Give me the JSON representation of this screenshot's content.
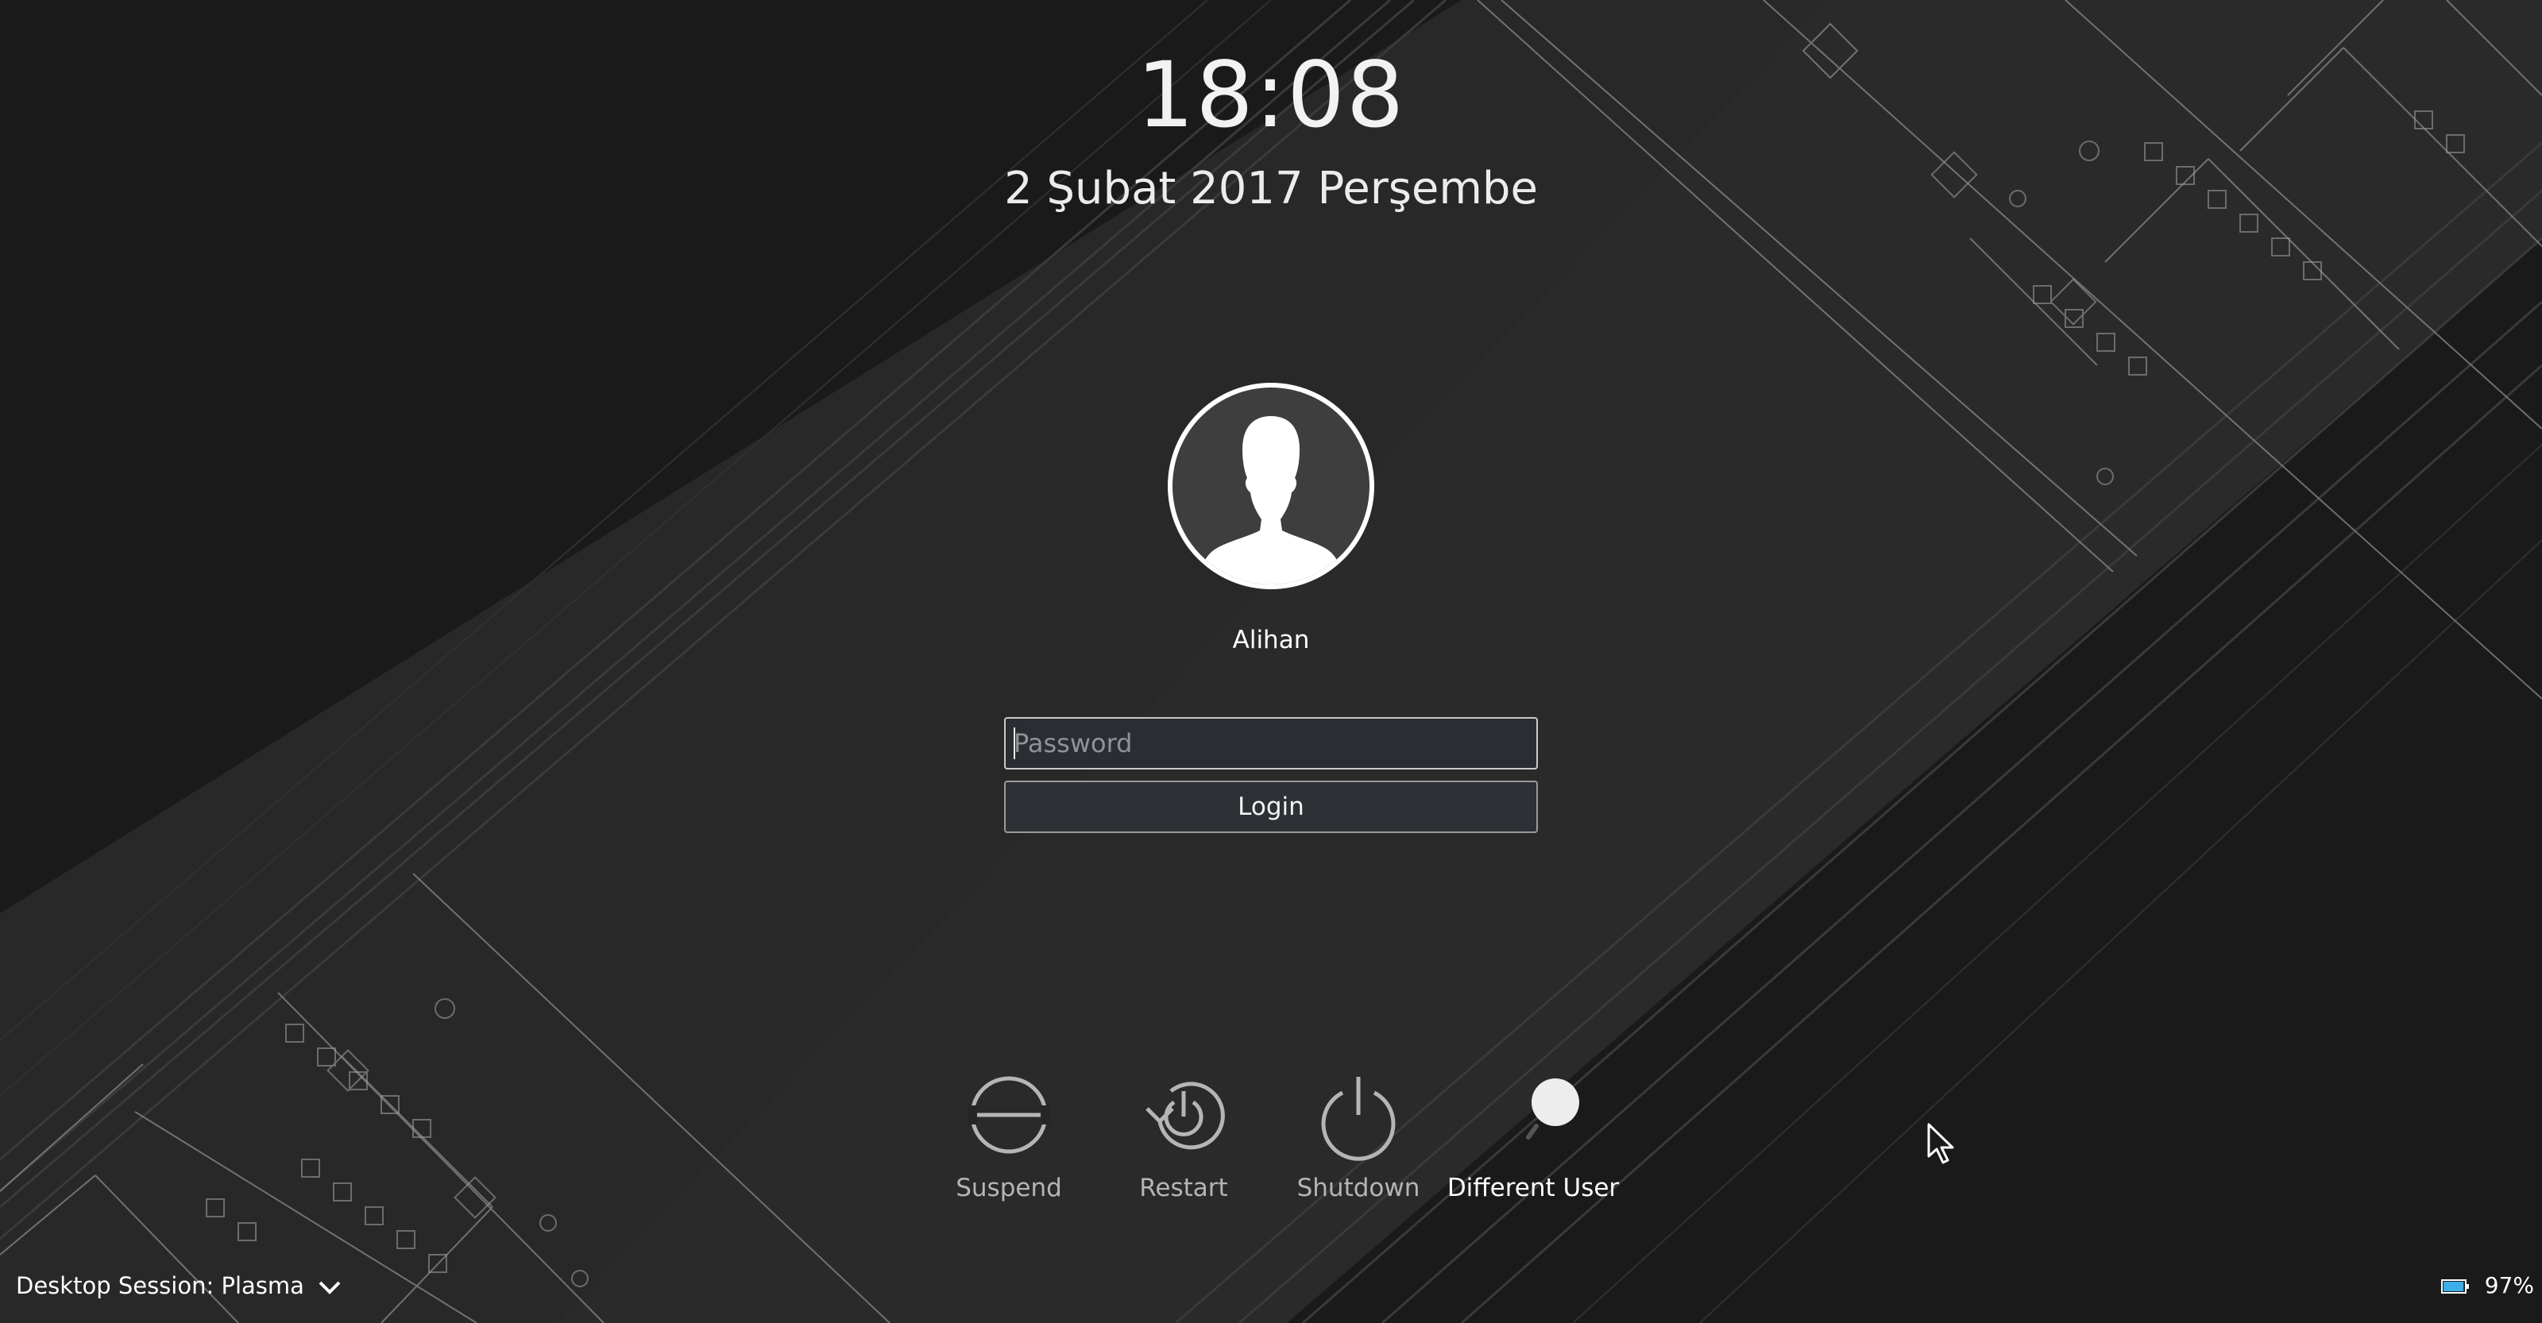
{
  "clock": {
    "time": "18:08",
    "date": "2 Şubat 2017 Perşembe"
  },
  "user": {
    "name": "Alihan"
  },
  "login": {
    "password_placeholder": "Password",
    "login_label": "Login"
  },
  "actions": [
    {
      "label": "Suspend",
      "icon": "suspend-icon"
    },
    {
      "label": "Restart",
      "icon": "restart-icon"
    },
    {
      "label": "Shutdown",
      "icon": "shutdown-icon"
    },
    {
      "label": "Different User",
      "icon": "different-user-icon"
    }
  ],
  "footer": {
    "session_label": "Desktop Session: Plasma",
    "battery_text": "97%",
    "battery_level": 0.97
  },
  "colors": {
    "background": "#1b1b1b",
    "panel": "#2a2d32",
    "text": "#ffffff",
    "muted_text": "#b5b5b5"
  }
}
